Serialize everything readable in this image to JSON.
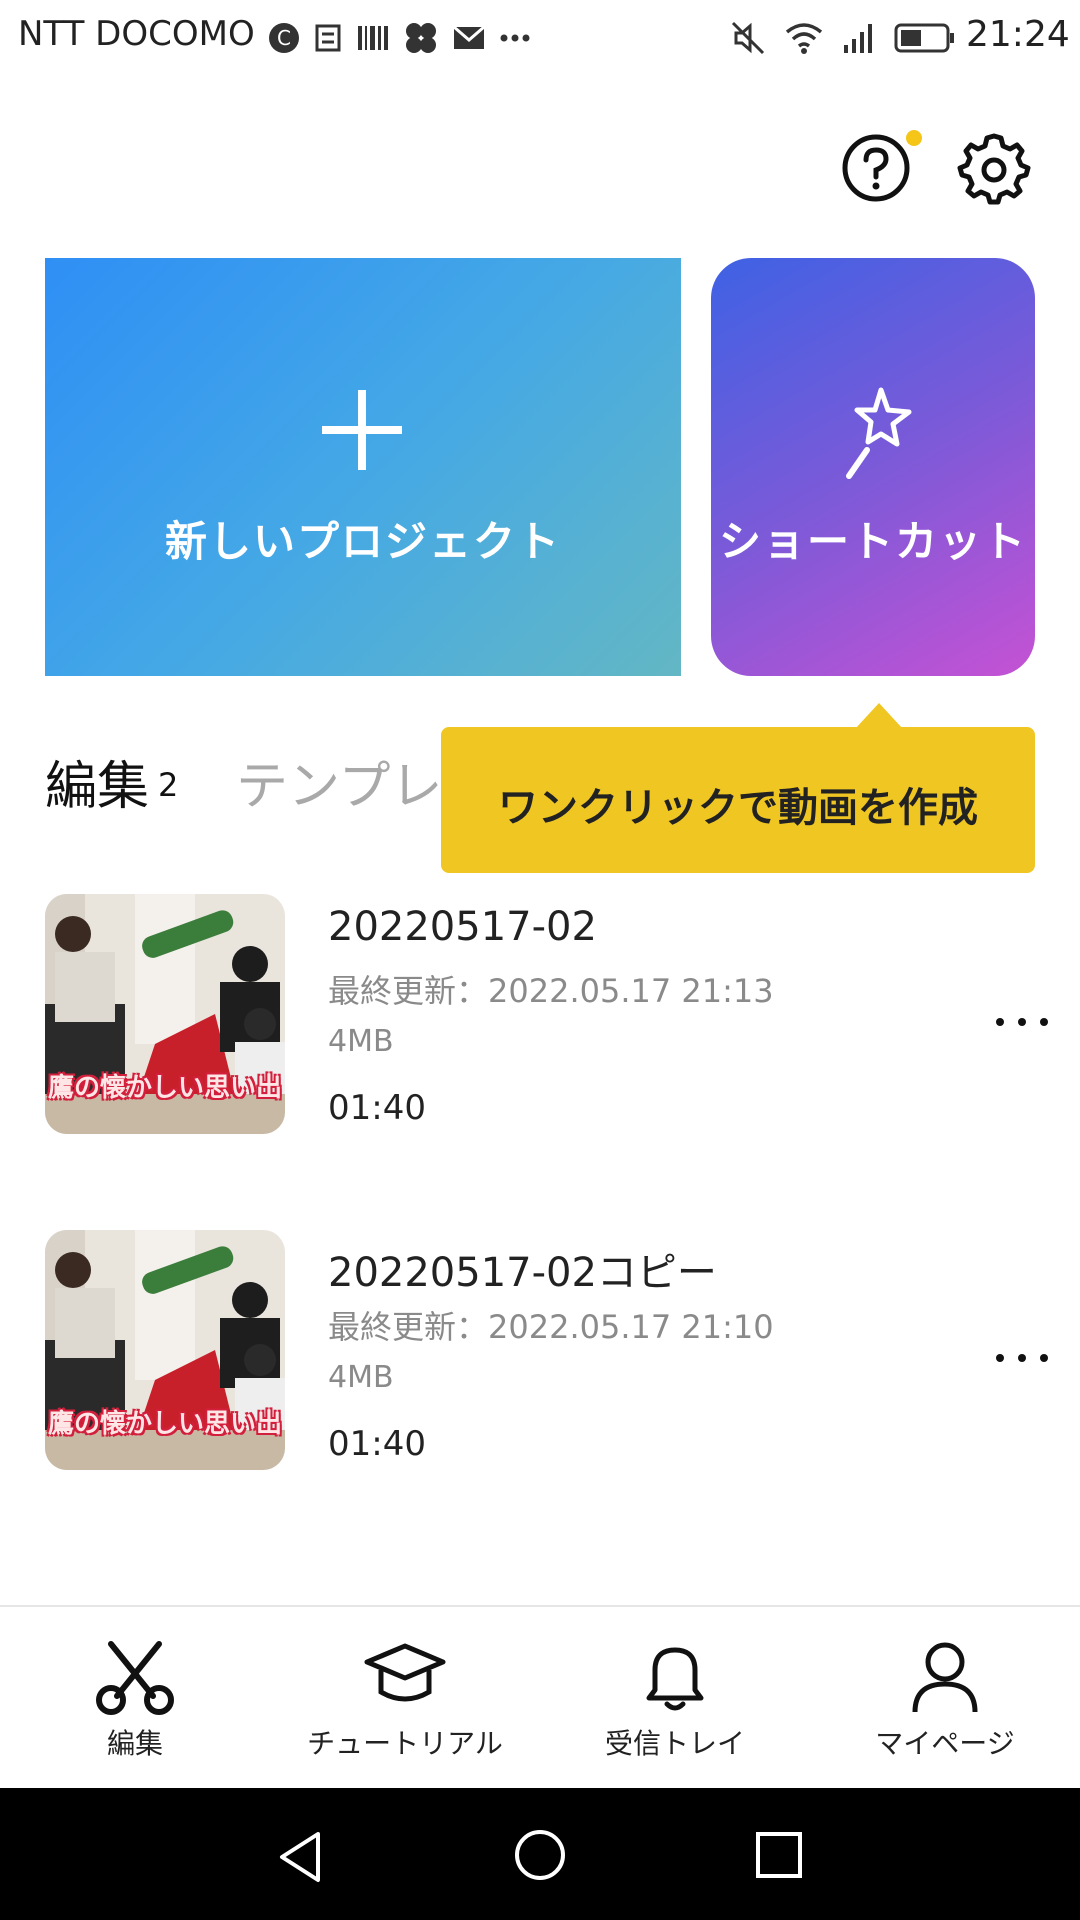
{
  "status_bar": {
    "carrier": "NTT DOCOMO",
    "time": "21:24"
  },
  "cards": {
    "new_project_label": "新しいプロジェクト",
    "shortcut_label": "ショートカット"
  },
  "tabs": {
    "edit_label": "編集",
    "edit_count": "2",
    "template_label": "テンプレ"
  },
  "tooltip": {
    "text": "ワンクリックで動画を作成"
  },
  "projects": [
    {
      "title": "20220517-02",
      "updated": "最終更新：2022.05.17 21:13",
      "size": "4MB",
      "duration": "01:40",
      "thumb_caption": "鷹の懐かしい思い出"
    },
    {
      "title": "20220517-02コピー",
      "updated": "最終更新：2022.05.17 21:10",
      "size": "4MB",
      "duration": "01:40",
      "thumb_caption": "鷹の懐かしい思い出"
    }
  ],
  "bottom_nav": [
    {
      "label": "編集",
      "icon": "scissors-icon"
    },
    {
      "label": "チュートリアル",
      "icon": "graduation-cap-icon"
    },
    {
      "label": "受信トレイ",
      "icon": "bell-icon"
    },
    {
      "label": "マイページ",
      "icon": "person-icon"
    }
  ],
  "colors": {
    "tooltip": "#f0c722",
    "notification_dot": "#f5c518",
    "new_project_gradient_start": "#2f8ff5",
    "shortcut_gradient_end": "#c552d4"
  }
}
